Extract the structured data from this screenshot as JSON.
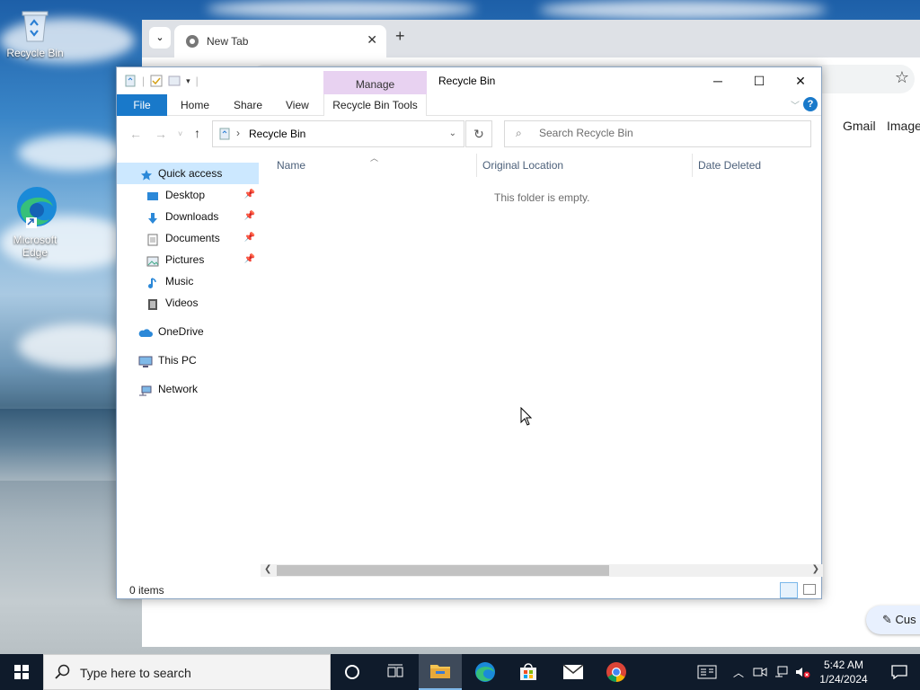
{
  "desktop": {
    "icons": [
      {
        "label": "Recycle Bin"
      },
      {
        "label": "Microsoft Edge"
      }
    ]
  },
  "browser": {
    "tab_title": "New Tab",
    "links": {
      "gmail": "Gmail",
      "images": "Images"
    },
    "customize_label": "Cus"
  },
  "explorer": {
    "window_title": "Recycle Bin",
    "manage_tab": "Manage",
    "ribbon": {
      "file": "File",
      "tabs": [
        "Home",
        "Share",
        "View"
      ],
      "context_tab": "Recycle Bin Tools"
    },
    "address": {
      "path": "Recycle Bin"
    },
    "search": {
      "placeholder": "Search Recycle Bin"
    },
    "nav": {
      "quick_access": "Quick access",
      "items": [
        "Desktop",
        "Downloads",
        "Documents",
        "Pictures",
        "Music",
        "Videos"
      ],
      "onedrive": "OneDrive",
      "this_pc": "This PC",
      "network": "Network"
    },
    "columns": [
      "Name",
      "Original Location",
      "Date Deleted"
    ],
    "empty_message": "This folder is empty.",
    "status": {
      "count": "0 items"
    }
  },
  "taskbar": {
    "search_placeholder": "Type here to search",
    "clock": {
      "time": "5:42 AM",
      "date": "1/24/2024"
    }
  },
  "colors": {
    "accent": "#1979ca",
    "manage_tab": "#e8d2f1",
    "selected": "#cce8ff",
    "taskbar": "#0f1b2b"
  }
}
